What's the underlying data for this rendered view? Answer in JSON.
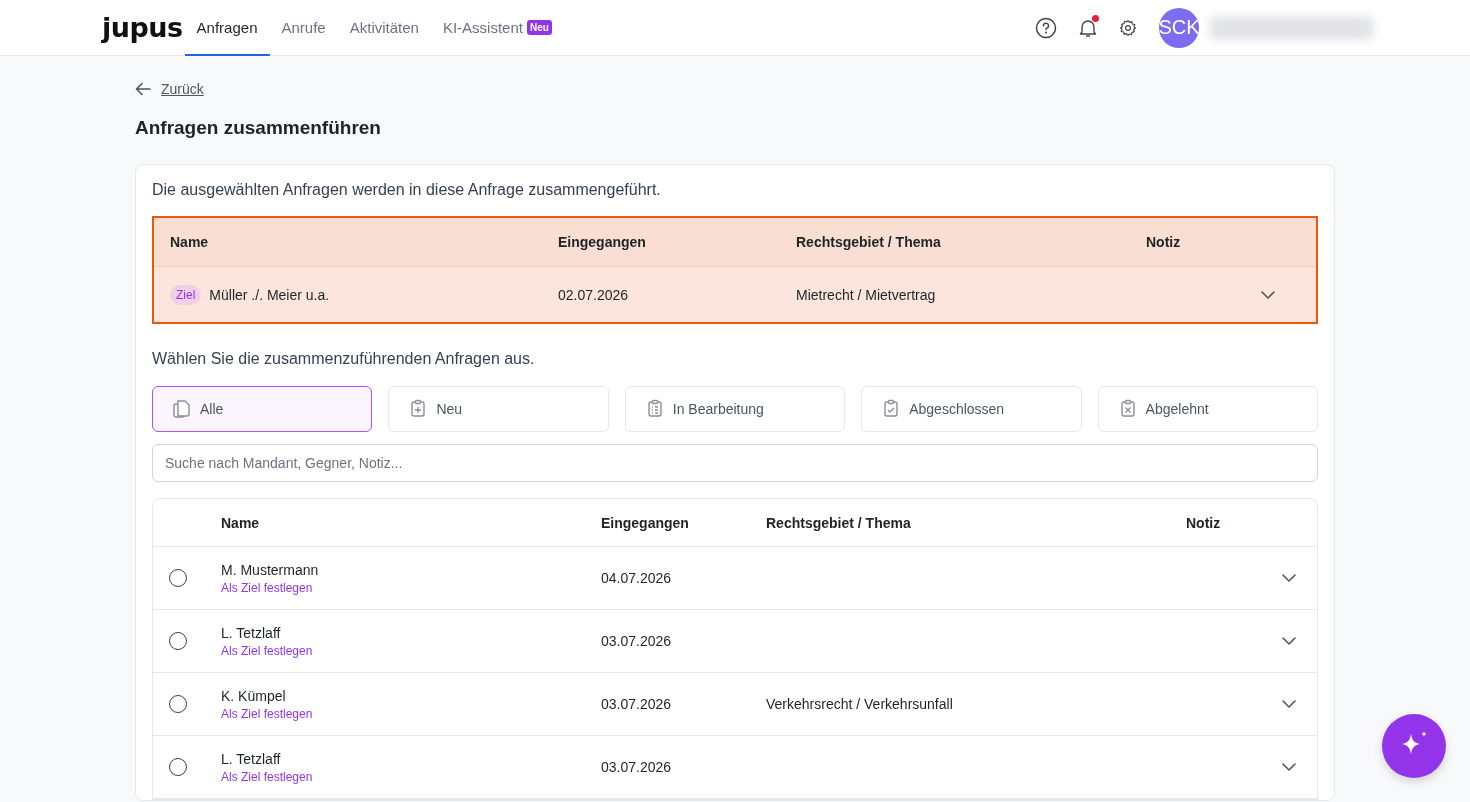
{
  "header": {
    "logo": "jupus",
    "nav": [
      {
        "label": "Anfragen",
        "selected": true
      },
      {
        "label": "Anrufe",
        "selected": false
      },
      {
        "label": "Aktivitäten",
        "selected": false
      },
      {
        "label": "KI-Assistent",
        "selected": false,
        "badge": "Neu"
      }
    ],
    "notifications_unread": true,
    "avatar": "SCK"
  },
  "back": "Zurück",
  "title": "Anfragen zusammenführen",
  "intro": "Die ausgewählten Anfragen werden in diese Anfrage zusammengeführt.",
  "target_table": {
    "columns": [
      "Name",
      "Eingegangen",
      "Rechtsgebiet / Thema",
      "Notiz"
    ],
    "row": {
      "tag": "Ziel",
      "name": "Müller ./. Meier u.a.",
      "received": "02.07.2026",
      "topic": "Mietrecht / Mietvertrag"
    }
  },
  "select_hint": "Wählen Sie die zusammenzuführenden Anfragen aus.",
  "filters": [
    {
      "label": "Alle",
      "kind": "all",
      "selected": true
    },
    {
      "label": "Neu",
      "kind": "new",
      "selected": false
    },
    {
      "label": "In Bearbeitung",
      "kind": "progress",
      "selected": false
    },
    {
      "label": "Abgeschlossen",
      "kind": "done",
      "selected": false
    },
    {
      "label": "Abgelehnt",
      "kind": "rejected",
      "selected": false
    }
  ],
  "search": {
    "placeholder": "Suche nach Mandant, Gegner, Notiz..."
  },
  "table": {
    "columns": [
      "Name",
      "Eingegangen",
      "Rechtsgebiet / Thema",
      "Notiz"
    ],
    "rows": [
      {
        "name": "M. Mustermann",
        "link": "Als Ziel festlegen",
        "received": "04.07.2026",
        "topic": "",
        "selected": false
      },
      {
        "name": "L. Tetzlaff",
        "link": "Als Ziel festlegen",
        "received": "03.07.2026",
        "topic": "",
        "selected": false
      },
      {
        "name": "K. Kümpel",
        "link": "Als Ziel festlegen",
        "received": "03.07.2026",
        "topic": "Verkehrsrecht / Verkehrsunfall",
        "selected": false
      },
      {
        "name": "L. Tetzlaff",
        "link": "Als Ziel festlegen",
        "received": "03.07.2026",
        "topic": "",
        "selected": false
      }
    ]
  }
}
